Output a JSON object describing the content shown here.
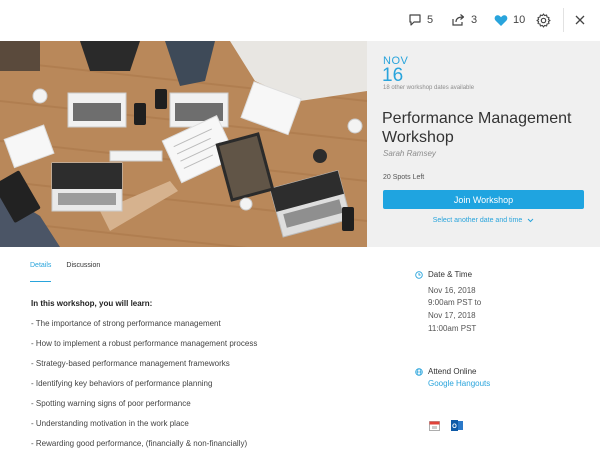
{
  "topbar": {
    "comments_count": "5",
    "shares_count": "3",
    "likes_count": "10",
    "accent_color": "#29a4dc"
  },
  "event": {
    "month": "NOV",
    "day": "16",
    "other_dates": "18 other workshop dates available",
    "title": "Performance Management Workshop",
    "author": "Sarah Ramsey",
    "spots": "20 Spots Left",
    "join_label": "Join Workshop",
    "select_date_label": "Select another date and time"
  },
  "tabs": [
    {
      "label": "Details",
      "active": true
    },
    {
      "label": "Discussion",
      "active": false
    }
  ],
  "content": {
    "heading": "In this workshop, you will learn:",
    "items": [
      "- The importance of strong performance management",
      "- How to implement a robust performance management process",
      "- Strategy-based performance management frameworks",
      "- Identifying key behaviors of performance planning",
      "- Spotting warning signs of poor performance",
      "- Understanding motivation in the work place",
      "- Rewarding good performance, (financially & non-financially)"
    ]
  },
  "details": {
    "date_label": "Date & Time",
    "date_lines": [
      "Nov 16, 2018",
      "9:00am PST to",
      "Nov 17, 2018",
      "11:00am PST"
    ],
    "attend_label": "Attend Online",
    "attend_link": "Google Hangouts"
  },
  "icons": {
    "comments": "comment-icon",
    "share": "share-icon",
    "like": "heart-icon",
    "settings": "gear-icon",
    "close": "close-icon",
    "clock": "clock-icon",
    "globe": "globe-icon",
    "calendar": "calendar-icon",
    "outlook": "outlook-icon",
    "chevron": "chevron-down-icon"
  }
}
